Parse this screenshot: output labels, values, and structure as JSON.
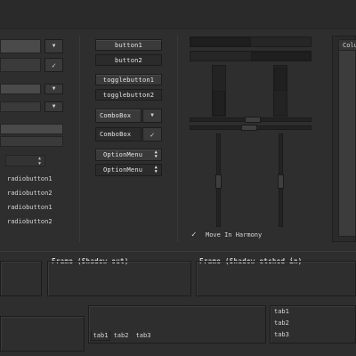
{
  "buttons": {
    "button1": "button1",
    "button2": "button2",
    "togglebutton1": "togglebutton1",
    "togglebutton2": "togglebutton2"
  },
  "combos": {
    "combo1": "ComboBox",
    "combo2": "ComboBox"
  },
  "option_menus": {
    "menu1": "OptionMenu",
    "menu2": "OptionMenu"
  },
  "radios": [
    "radiobutton1",
    "radiobutton2",
    "radiobutton1",
    "radiobutton2"
  ],
  "check": {
    "label": "Move In Harmony",
    "checked": true
  },
  "frames": {
    "shadow_out": "Frame (Shadow out)",
    "shadow_etched_in": "Frame (Shadow etched in)"
  },
  "tabs_bottom": [
    "tab1",
    "tab2",
    "tab3"
  ],
  "tabs_side": [
    "tab1",
    "tab2",
    "tab3"
  ],
  "tree": {
    "column": "Colu"
  },
  "icons": {
    "dropdown": "chevron-down-icon",
    "check": "check-icon",
    "spin": "spin-arrows-icon"
  }
}
